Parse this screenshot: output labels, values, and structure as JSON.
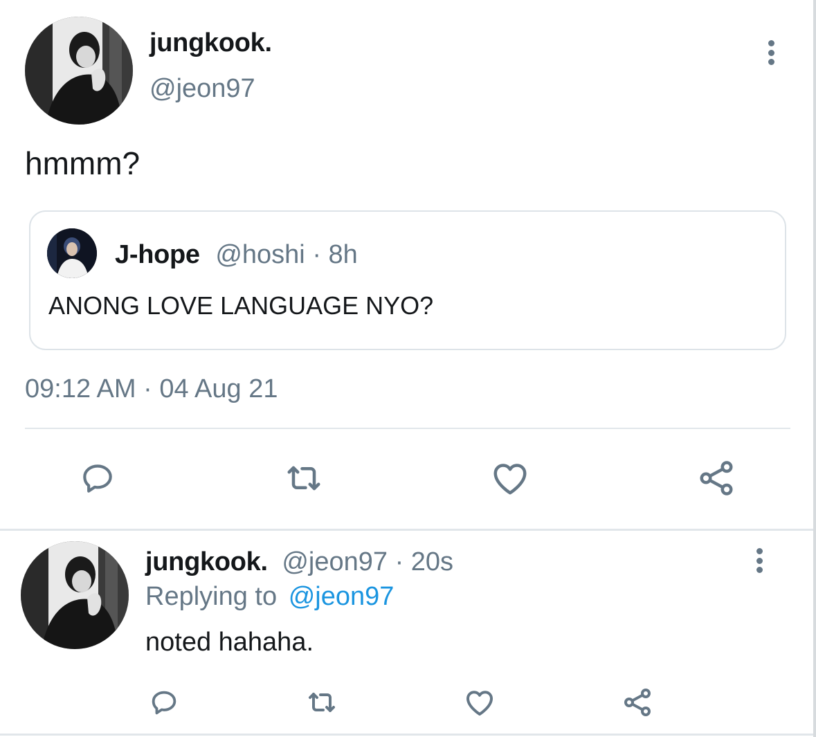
{
  "main_tweet": {
    "author_name": "jungkook.",
    "author_handle": "@jeon97",
    "text": "hmmm?",
    "timestamp": "09:12 AM · 04 Aug 21",
    "more_icon": "more-vertical-icon"
  },
  "quoted_tweet": {
    "author_name": "J-hope",
    "author_handle": "@hoshi",
    "separator": "·",
    "time": "8h",
    "text": "ANONG LOVE LANGUAGE NYO?"
  },
  "actions": {
    "reply_icon": "reply-icon",
    "retweet_icon": "retweet-icon",
    "like_icon": "heart-icon",
    "share_icon": "share-icon"
  },
  "reply_tweet": {
    "author_name": "jungkook.",
    "author_handle": "@jeon97",
    "separator": "·",
    "time": "20s",
    "replying_prefix": "Replying to",
    "replying_handle": "@jeon97",
    "text": "noted hahaha.",
    "more_icon": "more-vertical-icon"
  },
  "colors": {
    "text_primary": "#14171a",
    "text_secondary": "#657786",
    "link_blue": "#1b95e0",
    "divider": "#e1e6ea"
  }
}
